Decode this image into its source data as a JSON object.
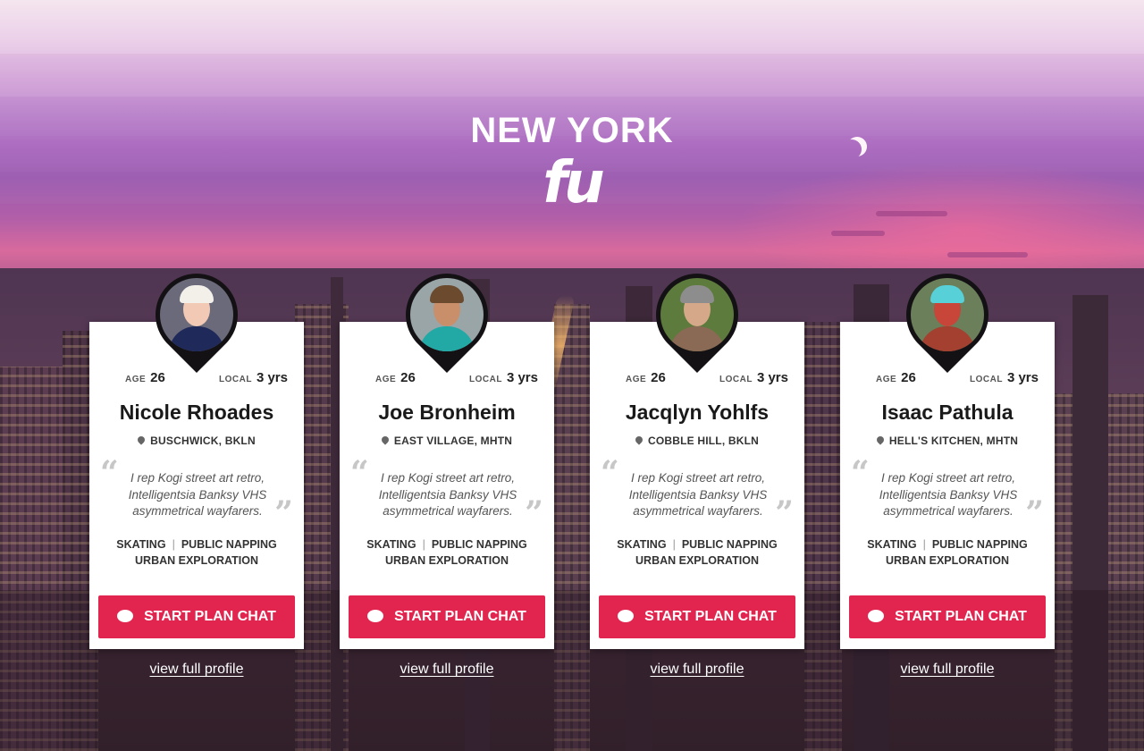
{
  "brand": {
    "title": "NEW YORK",
    "mark": "fu"
  },
  "colors": {
    "accent": "#e2254f",
    "card_bg": "#ffffff"
  },
  "labels": {
    "age": "AGE",
    "local": "LOCAL",
    "chat_button": "START PLAN CHAT",
    "profile_link": "view full profile"
  },
  "icons": {
    "pin": "map-pin-icon",
    "chat": "chat-bubble-icon",
    "quote_open": "open-quote-icon",
    "quote_close": "close-quote-icon"
  },
  "profiles": [
    {
      "name": "Nicole Rhoades",
      "age": "26",
      "local": "3 yrs",
      "location": "BUSCHWICK, BKLN",
      "quote": "I rep Kogi street art retro, Intelligentsia Banksy VHS asymmetrical wayfarers.",
      "interests": [
        "SKATING",
        "PUBLIC NAPPING",
        "URBAN EXPLORATION"
      ]
    },
    {
      "name": "Joe Bronheim",
      "age": "26",
      "local": "3 yrs",
      "location": "EAST VILLAGE, MHTN",
      "quote": "I rep Kogi street art retro, Intelligentsia Banksy VHS asymmetrical wayfarers.",
      "interests": [
        "SKATING",
        "PUBLIC NAPPING",
        "URBAN EXPLORATION"
      ]
    },
    {
      "name": "Jacqlyn Yohlfs",
      "age": "26",
      "local": "3 yrs",
      "location": "COBBLE HILL, BKLN",
      "quote": "I rep Kogi street art retro, Intelligentsia Banksy VHS asymmetrical wayfarers.",
      "interests": [
        "SKATING",
        "PUBLIC NAPPING",
        "URBAN EXPLORATION"
      ]
    },
    {
      "name": "Isaac Pathula",
      "age": "26",
      "local": "3 yrs",
      "location": "HELL'S KITCHEN, MHTN",
      "quote": "I rep Kogi street art retro, Intelligentsia Banksy VHS asymmetrical wayfarers.",
      "interests": [
        "SKATING",
        "PUBLIC NAPPING",
        "URBAN EXPLORATION"
      ]
    }
  ]
}
